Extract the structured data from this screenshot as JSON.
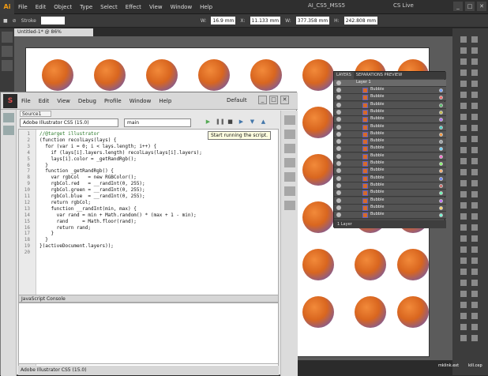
{
  "ai": {
    "menus": [
      "File",
      "Edit",
      "Object",
      "Type",
      "Select",
      "Effect",
      "View",
      "Window",
      "Help"
    ],
    "doc_title": "AI_CS5_MSS5",
    "cs_live": "CS Live",
    "controlbar": {
      "stroke_label": "Stroke",
      "w_label": "W:",
      "w_value": "16.9 mm",
      "x_label": "X:",
      "x_value": "11.133 mm",
      "w2_label": "W:",
      "w2_value": "377.358 mm",
      "h_label": "H:",
      "h_value": "242.808 mm"
    },
    "doc_tab": "Untitled-1* @ 86% (RGB/Preview)"
  },
  "estk": {
    "menus": [
      "File",
      "Edit",
      "View",
      "Debug",
      "Profile",
      "Window",
      "Help"
    ],
    "workspace": "Default",
    "doc_tab": "Source1",
    "target": "Adobe Illustrator CS5 (15.0)",
    "function": "main",
    "tooltip": "Start running the script.",
    "console_label": "JavaScript Console",
    "status": "Adobe Illustrator CS5 (15.0)",
    "code_lines": [
      {
        "n": "1",
        "t": "//@target illustrator"
      },
      {
        "n": "2",
        "t": "(function recolLays(lays) {"
      },
      {
        "n": "3",
        "t": "  for (var i = 0; i < lays.length; i++) {"
      },
      {
        "n": "4",
        "t": "    if (lays[i].layers.length) recolLays(lays[i].layers);"
      },
      {
        "n": "5",
        "t": "    lays[i].color = _getRandRgb();"
      },
      {
        "n": "6",
        "t": "  }"
      },
      {
        "n": "7",
        "t": "  function _getRandRgb() {"
      },
      {
        "n": "8",
        "t": "    var rgbCol   = new RGBColor();"
      },
      {
        "n": "9",
        "t": "    rgbCol.red   = __randInt(0, 255);"
      },
      {
        "n": "10",
        "t": "    rgbCol.green = __randInt(0, 255);"
      },
      {
        "n": "11",
        "t": "    rgbCol.blue  = __randInt(0, 255);"
      },
      {
        "n": "12",
        "t": "    return rgbCol;"
      },
      {
        "n": "13",
        "t": "    function __randInt(min, max) {"
      },
      {
        "n": "14",
        "t": "      var rand = min + Math.random() * (max + 1 - min);"
      },
      {
        "n": "15",
        "t": "      rand     = Math.floor(rand);"
      },
      {
        "n": "16",
        "t": "      return rand;"
      },
      {
        "n": "17",
        "t": "    }"
      },
      {
        "n": "18",
        "t": "  }"
      },
      {
        "n": "19",
        "t": "}(activeDocument.layers));"
      },
      {
        "n": "20",
        "t": ""
      }
    ]
  },
  "layers_panel": {
    "tabs": [
      "LAYERS",
      "SEPARATIONS PREVIEW"
    ],
    "top_layer": "Layer 1",
    "item_name": "Bubble",
    "footer": "1 Layer"
  },
  "desktop": {
    "icon1": "mklink.ext",
    "icon2": "kill.cep"
  }
}
